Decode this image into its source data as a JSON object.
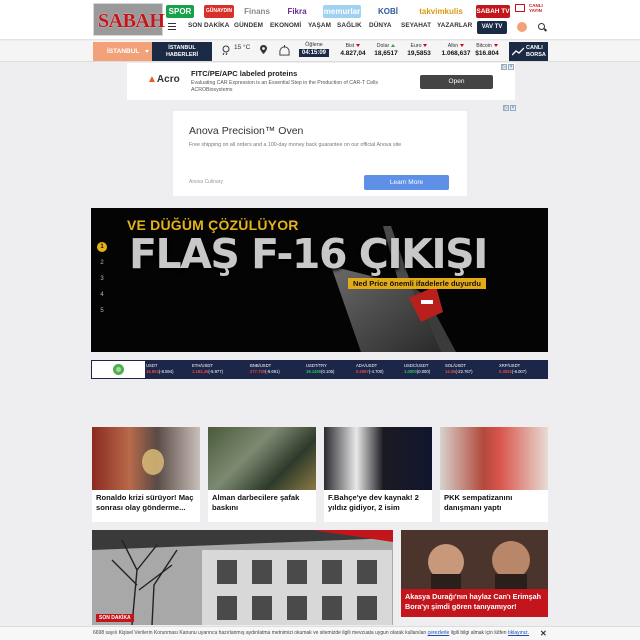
{
  "brand": {
    "logo": "SABAH",
    "sites": [
      {
        "label": "SPOR",
        "bg": "#17a24a",
        "fg": "#fff"
      },
      {
        "label": "GÜNAYDIN",
        "bg": "#d8312c",
        "fg": "#fff"
      },
      {
        "label": "Finans",
        "bg": "#fff",
        "fg": "#8a8a8a"
      },
      {
        "label": "Fikra",
        "bg": "#fff",
        "fg": "#6a2c91"
      },
      {
        "label": "memurlar",
        "bg": "#9fd1f1",
        "fg": "#fff"
      },
      {
        "label": "KOBİ",
        "bg": "#fff",
        "fg": "#2c5aa0"
      },
      {
        "label": "takvimkulis",
        "bg": "#fff",
        "fg": "#d99a12"
      },
      {
        "label": "SABAH TV",
        "bg": "#c3161c",
        "fg": "#fff"
      }
    ],
    "live": "CANLI YAYIN"
  },
  "nav": [
    "SON DAKİKA",
    "GÜNDEM",
    "EKONOMİ",
    "YAŞAM",
    "SAĞLIK",
    "DÜNYA",
    "SEYAHAT",
    "YAZARLAR"
  ],
  "vavtv": "VAV TV",
  "markets": {
    "city": "İSTANBUL",
    "news_button": [
      "İSTANBUL",
      "HABERLERİ"
    ],
    "temperature": "15 °C",
    "prayer_label": "Öğlene",
    "prayer_time": "04:15:09",
    "items": [
      {
        "name": "Bist",
        "value": "4.827,04",
        "trend": "down"
      },
      {
        "name": "Dolar",
        "value": "18,6517",
        "trend": "up"
      },
      {
        "name": "Euro",
        "value": "19,5853",
        "trend": "down"
      },
      {
        "name": "Altın",
        "value": "1.068,637",
        "trend": "down"
      },
      {
        "name": "Bitcoin",
        "value": "$16.804",
        "trend": "down"
      }
    ],
    "borsa": [
      "CANLI",
      "BORSA"
    ]
  },
  "ad_top": {
    "advertiser": "Acro",
    "title": "FITC/PE/APC labeled proteins",
    "description": "Evaluating CAR Expression is an Essential Step in the Production of CAR-T Cells",
    "sponsor": "ACROBiosystems",
    "cta": "Open"
  },
  "ad_mid": {
    "title": "Anova Precision™ Oven",
    "description": "Free shipping on all orders and a 100-day money back guarantee on our official Anova site",
    "sponsor": "Anova Culinary",
    "cta": "Learn More"
  },
  "hero": {
    "kicker": "VE DÜĞÜM ÇÖZÜLÜYOR",
    "headline": "FLAŞ F-16 ÇIKIŞI",
    "subheadline": "Ned Price önemli ifadelerle duyurdu",
    "slides": [
      "1",
      "2",
      "3",
      "4",
      "5"
    ],
    "active_slide": "1"
  },
  "crypto": [
    {
      "pair": "USDT",
      "value": "16.804",
      "change": "(-8.594)",
      "trend": "down"
    },
    {
      "pair": "ETH/USDT",
      "value": "1.183,45",
      "change": "(-5.977)",
      "trend": "down"
    },
    {
      "pair": "BNB/USDT",
      "value": "277.700",
      "change": "(-9.691)",
      "trend": "down"
    },
    {
      "pair": "USDT/TRY",
      "value": "19.1400",
      "change": "(0.105)",
      "trend": "up"
    },
    {
      "pair": "ADA/USDT",
      "value": "0.2697",
      "change": "(-4.700)",
      "trend": "down"
    },
    {
      "pair": "USDC/USDT",
      "value": "1.0000",
      "change": "(0.000)",
      "trend": "up"
    },
    {
      "pair": "SOL/USDT",
      "value": "14.05",
      "change": "(-22.767)",
      "trend": "down"
    },
    {
      "pair": "XRP/USDT",
      "value": "0.3532",
      "change": "(-6.007)",
      "trend": "down"
    }
  ],
  "cards": [
    {
      "title": "Ronaldo krizi sürüyor! Maç sonrası olay gönderme..."
    },
    {
      "title": "Alman darbecilere şafak baskını"
    },
    {
      "title": "F.Bahçe'ye dev kaynak! 2 yıldız gidiyor, 2 isim"
    },
    {
      "title": "PKK sempatizanını danışmanı yaptı"
    }
  ],
  "feature": {
    "tag": "SON DAKİKA"
  },
  "side_story": {
    "title": "Akasya Durağı'nın haylaz Can'ı Erimşah Bora'yı şimdi gören tanıyamıyor!"
  },
  "cookie": {
    "text": "6698 sayılı Kişisel Verilerin Korunması Kanunu uyarınca hazırlanmış aydınlatma metnimizi okumak ve sitemizde ilgili mevzuata uygun olarak kullanılan",
    "link1": "çerezlerle",
    "mid": "ilgili bilgi almak için lütfen",
    "link2": "tıklayınız.",
    "close": "✕"
  }
}
